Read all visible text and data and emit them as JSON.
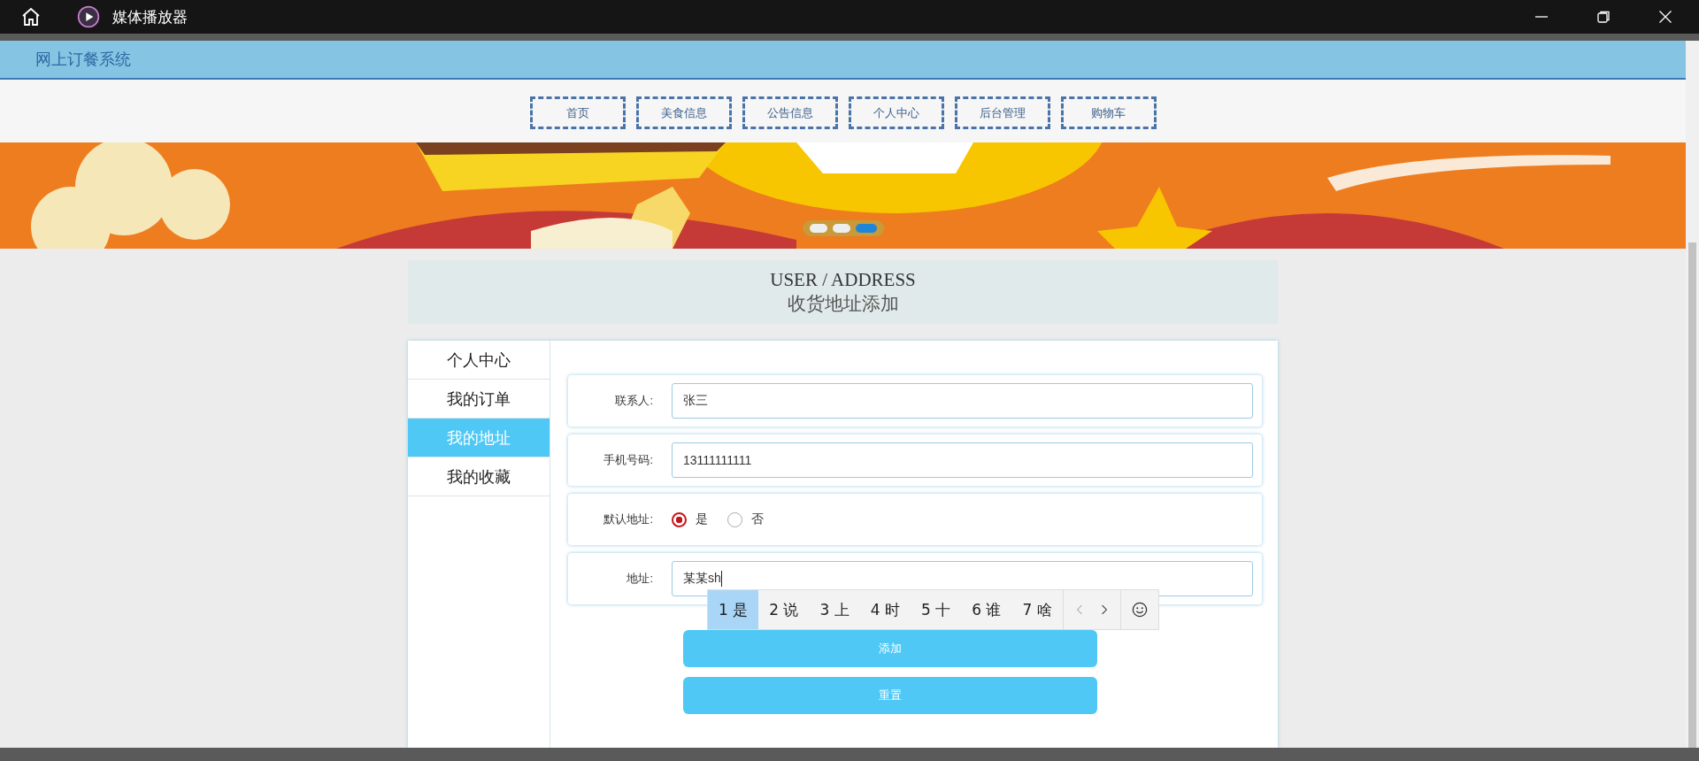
{
  "window": {
    "title": "媒体播放器"
  },
  "site": {
    "title": "网上订餐系统"
  },
  "nav": [
    {
      "label": "首页"
    },
    {
      "label": "美食信息"
    },
    {
      "label": "公告信息"
    },
    {
      "label": "个人中心"
    },
    {
      "label": "后台管理"
    },
    {
      "label": "购物车"
    }
  ],
  "banner": {
    "kind": "picture",
    "dots": [
      {
        "selected": false
      },
      {
        "selected": false
      },
      {
        "selected": true
      }
    ]
  },
  "heading": {
    "title": "USER / ADDRESS",
    "subtitle": "收货地址添加"
  },
  "sidebar": {
    "items": [
      {
        "label": "个人中心",
        "selected": false
      },
      {
        "label": "我的订单",
        "selected": false
      },
      {
        "label": "我的地址",
        "selected": true
      },
      {
        "label": "我的收藏",
        "selected": false
      }
    ]
  },
  "form": {
    "rows": [
      {
        "kind": "input",
        "label": "联系人:",
        "value": "张三"
      },
      {
        "kind": "input",
        "label": "手机号码:",
        "value": "13111111111"
      },
      {
        "kind": "radio",
        "label": "默认地址:",
        "options": [
          {
            "label": "是",
            "selected": true
          },
          {
            "label": "否",
            "selected": false
          }
        ]
      },
      {
        "kind": "input",
        "label": "地址:",
        "value": "某某sh"
      }
    ],
    "buttons": [
      "添加",
      "重置"
    ]
  },
  "ime": {
    "candidates": [
      {
        "label": "1 是",
        "selected": true
      },
      {
        "label": "2 说",
        "selected": false
      },
      {
        "label": "3 上",
        "selected": false
      },
      {
        "label": "4 时",
        "selected": false
      },
      {
        "label": "5 十",
        "selected": false
      },
      {
        "label": "6 谁",
        "selected": false
      },
      {
        "label": "7 啥",
        "selected": false
      }
    ]
  }
}
